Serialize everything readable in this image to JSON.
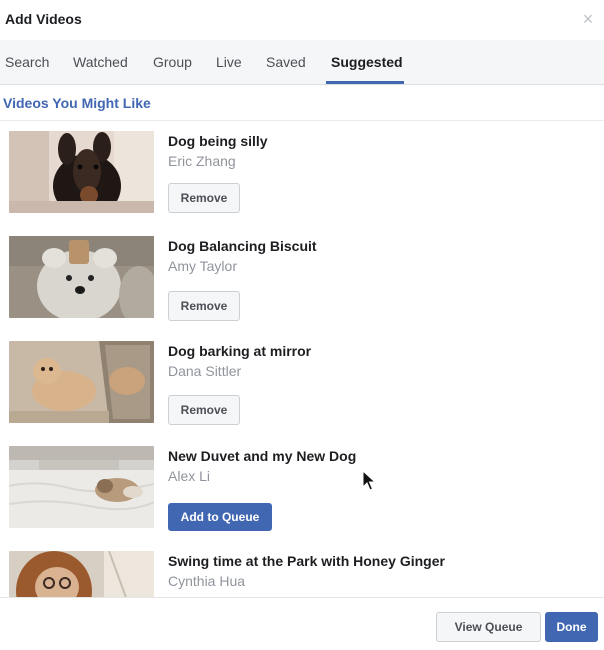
{
  "dialog": {
    "title": "Add Videos",
    "close_icon": "close-icon",
    "close_glyph": "×"
  },
  "tabs": [
    {
      "label": "Search",
      "active": false
    },
    {
      "label": "Watched",
      "active": false
    },
    {
      "label": "Group",
      "active": false
    },
    {
      "label": "Live",
      "active": false
    },
    {
      "label": "Saved",
      "active": false
    },
    {
      "label": "Suggested",
      "active": true
    }
  ],
  "section": {
    "title": "Videos You Might Like"
  },
  "videos": [
    {
      "title": "Dog being silly",
      "author": "Eric Zhang",
      "action": "Remove"
    },
    {
      "title": "Dog Balancing Biscuit",
      "author": "Amy Taylor",
      "action": "Remove"
    },
    {
      "title": "Dog barking at mirror",
      "author": "Dana Sittler",
      "action": "Remove"
    },
    {
      "title": "New Duvet and my New Dog",
      "author": "Alex Li",
      "action": "Add to Queue"
    },
    {
      "title": "Swing time at the Park with Honey Ginger",
      "author": "Cynthia Hua",
      "action": ""
    }
  ],
  "footer": {
    "view_queue_label": "View Queue",
    "done_label": "Done"
  },
  "colors": {
    "accent": "#4267b2",
    "tab_bar_bg": "#f5f6f7",
    "secondary_text": "#90949c"
  }
}
